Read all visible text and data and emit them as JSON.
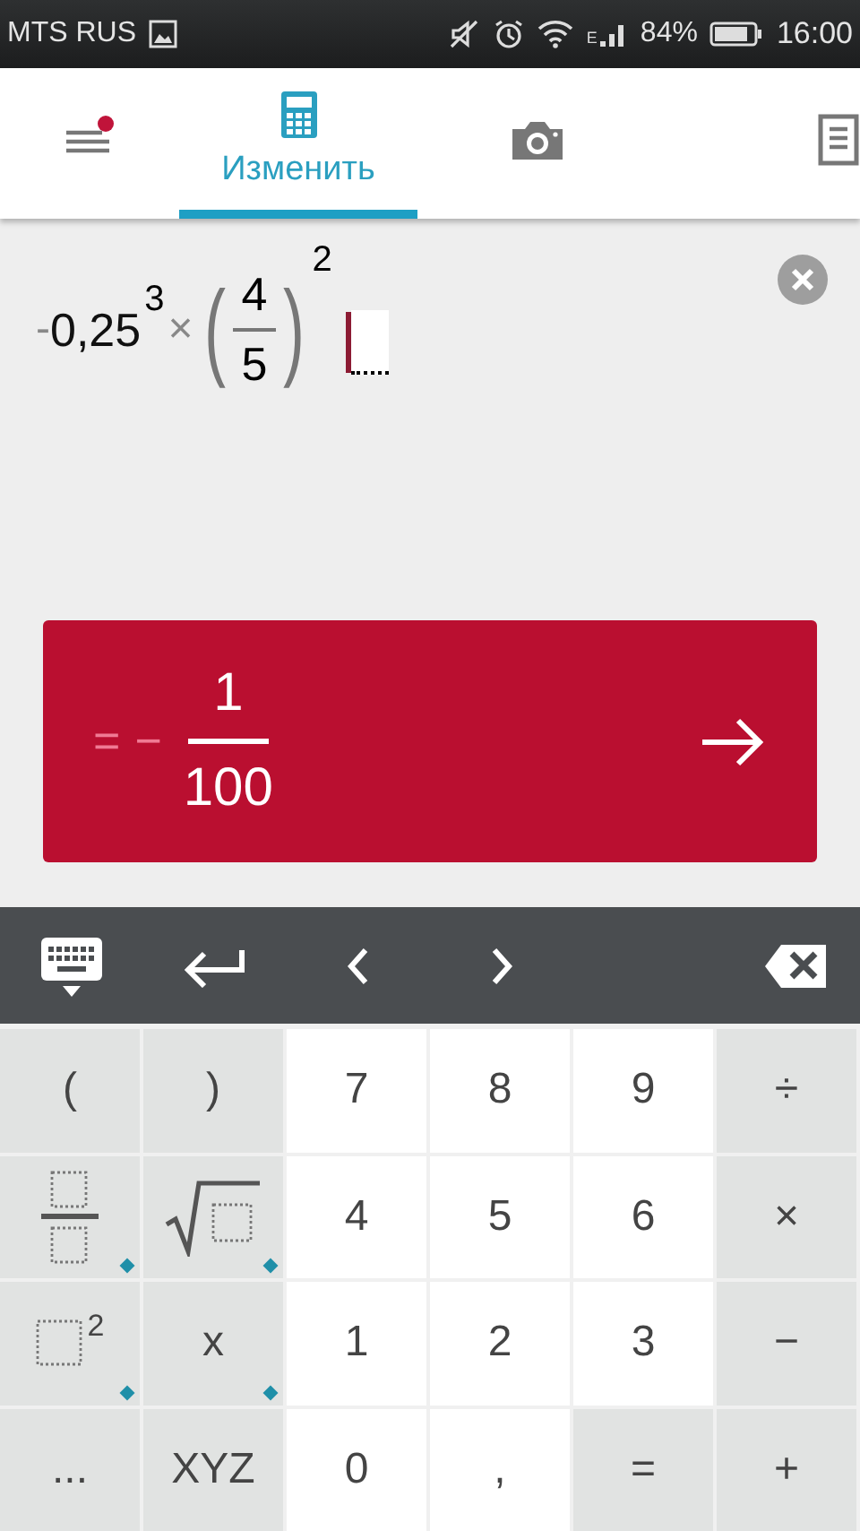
{
  "status_bar": {
    "carrier": "MTS RUS",
    "network": "E",
    "battery": "84%",
    "time": "16:00"
  },
  "app_bar": {
    "menu_badge": true,
    "tabs": [
      {
        "kind": "calculator",
        "label": "Изменить",
        "selected": true
      },
      {
        "kind": "camera",
        "selected": false
      },
      {
        "kind": "notes",
        "selected": false
      }
    ]
  },
  "expression": {
    "sign": "-",
    "base": "0,25",
    "base_exponent": "3",
    "operator": "×",
    "open_paren": "(",
    "numerator": "4",
    "denominator": "5",
    "close_paren": ")",
    "exponent": "2"
  },
  "result": {
    "equals": "=",
    "sign": "−",
    "numerator": "1",
    "denominator": "100"
  },
  "keys": [
    {
      "kind": "text",
      "label": "(",
      "secondary": true,
      "more": false
    },
    {
      "kind": "text",
      "label": ")",
      "secondary": true,
      "more": false
    },
    {
      "kind": "text",
      "label": "7",
      "secondary": false,
      "more": false
    },
    {
      "kind": "text",
      "label": "8",
      "secondary": false,
      "more": false
    },
    {
      "kind": "text",
      "label": "9",
      "secondary": false,
      "more": false
    },
    {
      "kind": "text",
      "label": "÷",
      "secondary": true,
      "more": false
    },
    {
      "kind": "fraction",
      "secondary": true,
      "more": true
    },
    {
      "kind": "root",
      "secondary": true,
      "more": true
    },
    {
      "kind": "text",
      "label": "4",
      "secondary": false,
      "more": false
    },
    {
      "kind": "text",
      "label": "5",
      "secondary": false,
      "more": false
    },
    {
      "kind": "text",
      "label": "6",
      "secondary": false,
      "more": false
    },
    {
      "kind": "text",
      "label": "×",
      "secondary": true,
      "more": false
    },
    {
      "kind": "power",
      "label": "2",
      "secondary": true,
      "more": true
    },
    {
      "kind": "text",
      "label": "x",
      "secondary": true,
      "more": true
    },
    {
      "kind": "text",
      "label": "1",
      "secondary": false,
      "more": false
    },
    {
      "kind": "text",
      "label": "2",
      "secondary": false,
      "more": false
    },
    {
      "kind": "text",
      "label": "3",
      "secondary": false,
      "more": false
    },
    {
      "kind": "text",
      "label": "−",
      "secondary": true,
      "more": false
    },
    {
      "kind": "text",
      "label": "...",
      "secondary": true,
      "more": false
    },
    {
      "kind": "text",
      "label": "XYZ",
      "secondary": true,
      "more": false
    },
    {
      "kind": "text",
      "label": "0",
      "secondary": false,
      "more": false
    },
    {
      "kind": "text",
      "label": ",",
      "secondary": false,
      "more": false
    },
    {
      "kind": "text",
      "label": "=",
      "secondary": true,
      "more": false
    },
    {
      "kind": "text",
      "label": "+",
      "secondary": true,
      "more": false
    }
  ]
}
